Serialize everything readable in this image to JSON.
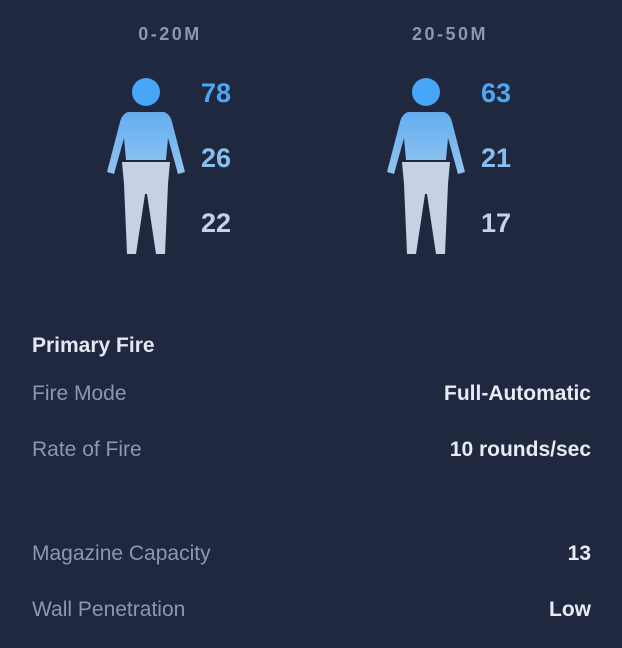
{
  "ranges": [
    {
      "label": "0-20M",
      "head": "78",
      "body": "26",
      "legs": "22"
    },
    {
      "label": "20-50M",
      "head": "63",
      "body": "21",
      "legs": "17"
    }
  ],
  "colors": {
    "background": "#202840",
    "head": "#4aa8f5",
    "body": "#86c1ee",
    "legs": "#c7d1e4",
    "label": "#8e97ab",
    "value": "#e6ebf4"
  },
  "primary_fire": {
    "title": "Primary Fire",
    "fire_mode_label": "Fire Mode",
    "fire_mode_value": "Full-Automatic",
    "rate_label": "Rate of Fire",
    "rate_value": "10 rounds/sec"
  },
  "stats": {
    "magazine_label": "Magazine Capacity",
    "magazine_value": "13",
    "penetration_label": "Wall Penetration",
    "penetration_value": "Low"
  },
  "icons": {
    "figure": "body-figure-icon"
  }
}
